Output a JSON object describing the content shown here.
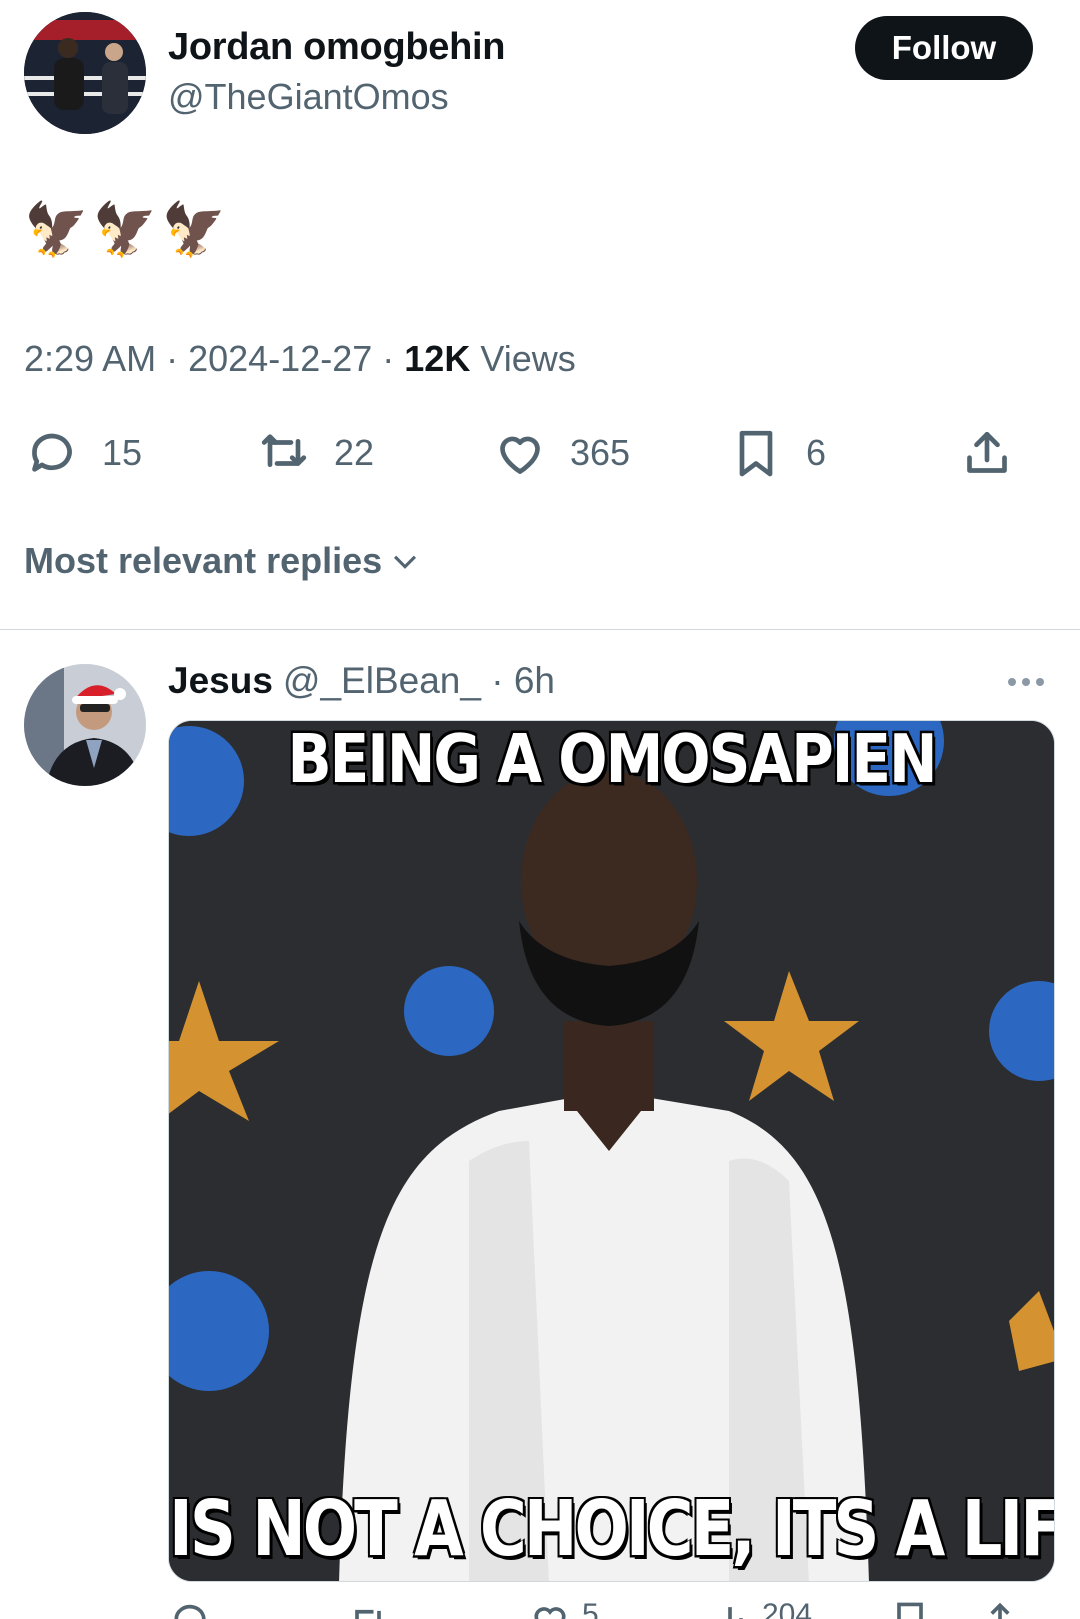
{
  "tweet": {
    "author": {
      "display_name": "Jordan omogbehin",
      "handle": "@TheGiantOmos"
    },
    "follow_label": "Follow",
    "text": "🦅🦅🦅",
    "time": "2:29 AM",
    "date": "2024-12-27",
    "views_count": "12K",
    "views_label": "Views",
    "stats": {
      "replies": "15",
      "reposts": "22",
      "likes": "365",
      "bookmarks": "6"
    }
  },
  "replies_sort_label": "Most relevant replies",
  "reply": {
    "display_name": "Jesus",
    "handle": "@_ElBean_",
    "age": "6h",
    "meme": {
      "top_text": "BEING A OMOSAPIEN",
      "bottom_text": "IS NOT A CHOICE, ITS A LIFESTYLE."
    },
    "partial_counts": {
      "likes": "5",
      "views": "204"
    }
  },
  "colors": {
    "text": "#0f1419",
    "secondary": "#536471",
    "follow_bg": "#0f1419",
    "divider": "#cfd9de",
    "backdrop": "#2a2c30"
  }
}
